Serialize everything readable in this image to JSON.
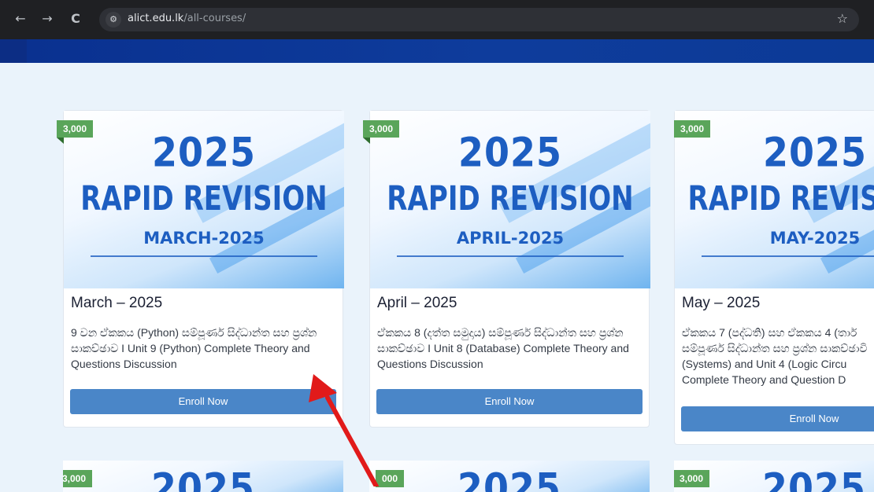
{
  "browser": {
    "url_domain": "alict.edu.lk",
    "url_path": "/all-courses/",
    "back_icon": "←",
    "forward_icon": "→",
    "reload_icon": "C",
    "site_info_icon": "⚙",
    "star_icon": "☆"
  },
  "courses": [
    {
      "price": "3,000",
      "poster_year": "2025",
      "poster_title": "RAPID REVISION",
      "poster_month": "MARCH-2025",
      "title": "March – 2025",
      "description": "9 වන ඒකකය (Python) සම්පූර්ණ සිද්ධාන්ත සහ ප්‍රශ්න සාකච්ඡාව I Unit 9 (Python) Complete Theory and Questions Discussion",
      "button": "Enroll Now"
    },
    {
      "price": "3,000",
      "poster_year": "2025",
      "poster_title": "RAPID REVISION",
      "poster_month": "APRIL-2025",
      "title": "April – 2025",
      "description": "ඒකකය 8 (දත්ත සමුදාය) සම්පූර්ණ සිද්ධාන්ත සහ ප්‍රශ්න සාකච්ඡාව I Unit 8 (Database) Complete Theory and Questions Discussion",
      "button": "Enroll Now"
    },
    {
      "price": "3,000",
      "poster_year": "2025",
      "poster_title": "RAPID REVIS",
      "poster_month": "MAY-2025",
      "title": "May – 2025",
      "description": "ඒකකය 7 (පද්ධති) සහ ඒකකය 4 (තාර් සම්පූර්ණ සිද්ධාන්ත සහ ප්‍රශ්න සාකච්ඡාවි (Systems) and Unit 4 (Logic Circu Complete Theory and Question D",
      "button": "Enroll Now"
    }
  ],
  "second_row": [
    {
      "price": "3,000",
      "poster_year": "2025"
    },
    {
      "price": "000",
      "poster_year": "2025"
    },
    {
      "price": "3,000",
      "poster_year": "2025"
    }
  ],
  "colors": {
    "price_badge": "#5aa55a",
    "enroll_button": "#4a86c8",
    "poster_text": "#1d5ec1",
    "annotation_arrow": "#e11a1a"
  }
}
